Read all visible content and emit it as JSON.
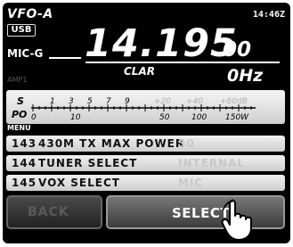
{
  "header": {
    "vfo": "VFO-A",
    "mode": "USB",
    "clock": "14:46Z",
    "mic_gain": "MIC-G"
  },
  "frequency": {
    "main": "14.195",
    "sub": "00"
  },
  "clarifier": {
    "label": "CLAR",
    "value": "0Hz"
  },
  "amp_label": "AMP1",
  "meter": {
    "s_label": "S",
    "po_label": "PO",
    "s_scale": [
      "1",
      "3",
      "5",
      "7",
      "9",
      "+20",
      "+40",
      "+60dB"
    ],
    "po_scale": [
      "0",
      "10",
      "50",
      "100",
      "150W"
    ]
  },
  "menu": {
    "title": "MENU",
    "items": [
      {
        "num": "143",
        "name": "430M TX MAX POWER",
        "value": "50"
      },
      {
        "num": "144",
        "name": "TUNER SELECT",
        "value": "INTERNAL"
      },
      {
        "num": "145",
        "name": "VOX SELECT",
        "value": "MIC"
      }
    ]
  },
  "buttons": {
    "back": "BACK",
    "select": "SELECT"
  },
  "colors": {
    "screen": "#000000",
    "row": "#e0e0e0",
    "dim_text": "#c8c8c8"
  }
}
